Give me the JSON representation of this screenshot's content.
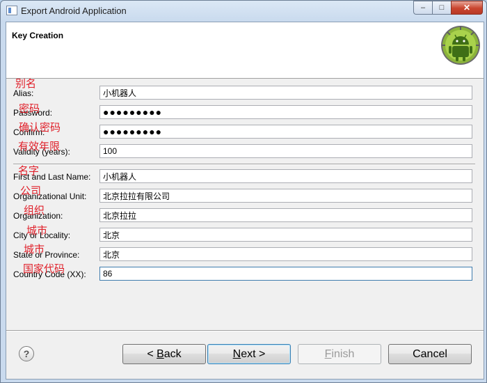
{
  "window": {
    "title": "Export Android Application",
    "controls": {
      "minimize": "–",
      "maximize": "□",
      "close": "✕"
    }
  },
  "header": {
    "title": "Key Creation",
    "icon": "android-logo"
  },
  "fields": {
    "alias": {
      "label": "Alias:",
      "value": "小机器人",
      "note": "别名"
    },
    "password": {
      "label": "Password:",
      "value": "●●●●●●●●●",
      "note": "密码"
    },
    "confirm": {
      "label": "Confirm:",
      "value": "●●●●●●●●●",
      "note": "确认密码"
    },
    "validity": {
      "label": "Validity (years):",
      "value": "100",
      "note": "有效年限"
    },
    "name": {
      "label": "First and Last Name:",
      "value": "小机器人",
      "note": "名字"
    },
    "org_unit": {
      "label": "Organizational Unit:",
      "value": "北京拉拉有限公司",
      "note": "公司"
    },
    "organization": {
      "label": "Organization:",
      "value": "北京拉拉",
      "note": "组织"
    },
    "city": {
      "label": "City or Locality:",
      "value": "北京",
      "note": "城市"
    },
    "state": {
      "label": "State or Province:",
      "value": "北京",
      "note": "城市"
    },
    "country": {
      "label": "Country Code (XX):",
      "value": "86",
      "note": "国家代码"
    }
  },
  "buttons": {
    "back": {
      "prefix": "< ",
      "mnemonic": "B",
      "rest": "ack"
    },
    "next": {
      "mnemonic": "N",
      "rest": "ext >"
    },
    "finish": {
      "mnemonic": "F",
      "rest": "inish"
    },
    "cancel": "Cancel",
    "help": "?"
  },
  "colors": {
    "note_red": "#e0202a",
    "android_green": "#9bc53d"
  }
}
